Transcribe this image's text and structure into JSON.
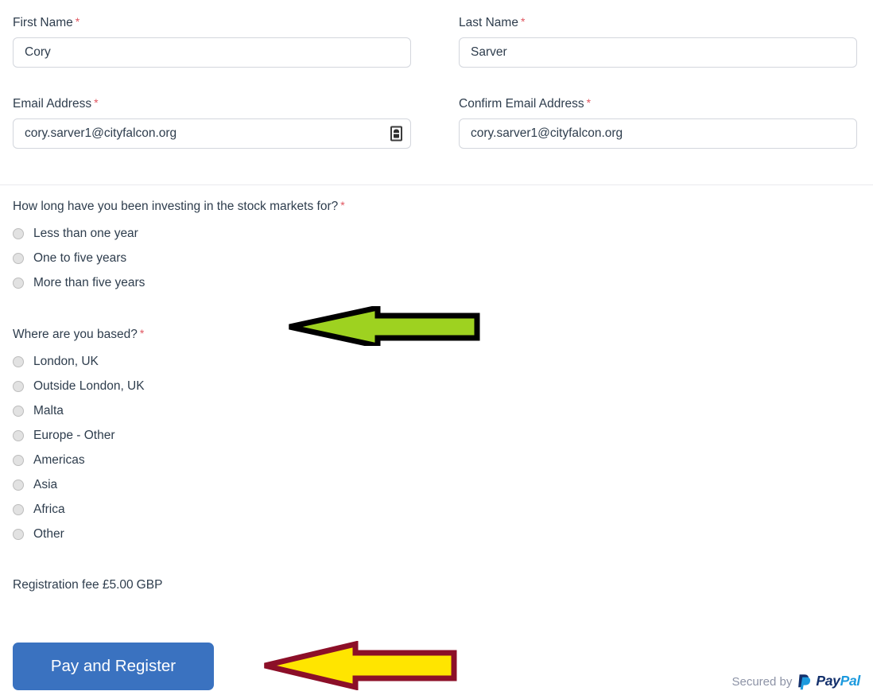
{
  "form": {
    "fields": [
      {
        "name": "first-name",
        "label": "First Name",
        "required_mark": "*",
        "value": "Cory",
        "placeholder": ""
      },
      {
        "name": "last-name",
        "label": "Last Name",
        "required_mark": "*",
        "value": "Sarver",
        "placeholder": ""
      },
      {
        "name": "email-address",
        "label": "Email Address",
        "required_mark": "*",
        "value": "cory.sarver1@cityfalcon.org",
        "placeholder": "",
        "icon": "autofill-icon"
      },
      {
        "name": "confirm-email-address",
        "label": "Confirm Email Address",
        "required_mark": "*",
        "value": "cory.sarver1@cityfalcon.org",
        "placeholder": ""
      }
    ],
    "questions": [
      {
        "name": "investing-experience",
        "label": "How long have you been investing in the stock markets for?",
        "required_mark": "*",
        "options": [
          "Less than one year",
          "One to five years",
          "More than five years"
        ]
      },
      {
        "name": "location",
        "label": "Where are you based?",
        "required_mark": "*",
        "options": [
          "London, UK",
          "Outside London, UK",
          "Malta",
          "Europe - Other",
          "Americas",
          "Asia",
          "Africa",
          "Other"
        ]
      }
    ],
    "fee": {
      "text": "Registration fee",
      "amount": "£5.00",
      "currency": "GBP"
    },
    "submit_label": "Pay and Register"
  },
  "footer": {
    "secured_by": "Secured by",
    "brand_pay": "Pay",
    "brand_pal": "Pal"
  },
  "annotations": [
    {
      "name": "green-arrow",
      "direction": "left",
      "fill": "#9ed220",
      "stroke": "#000000"
    },
    {
      "name": "yellow-arrow",
      "direction": "left",
      "fill": "#ffe500",
      "stroke": "#8c0f28"
    }
  ],
  "colors": {
    "accent_button": "#3a72c0",
    "required_star": "#e0555f",
    "label_text": "#2e3d4d",
    "input_border": "#d3d6dd",
    "radio_fill": "#e2e2e2"
  }
}
